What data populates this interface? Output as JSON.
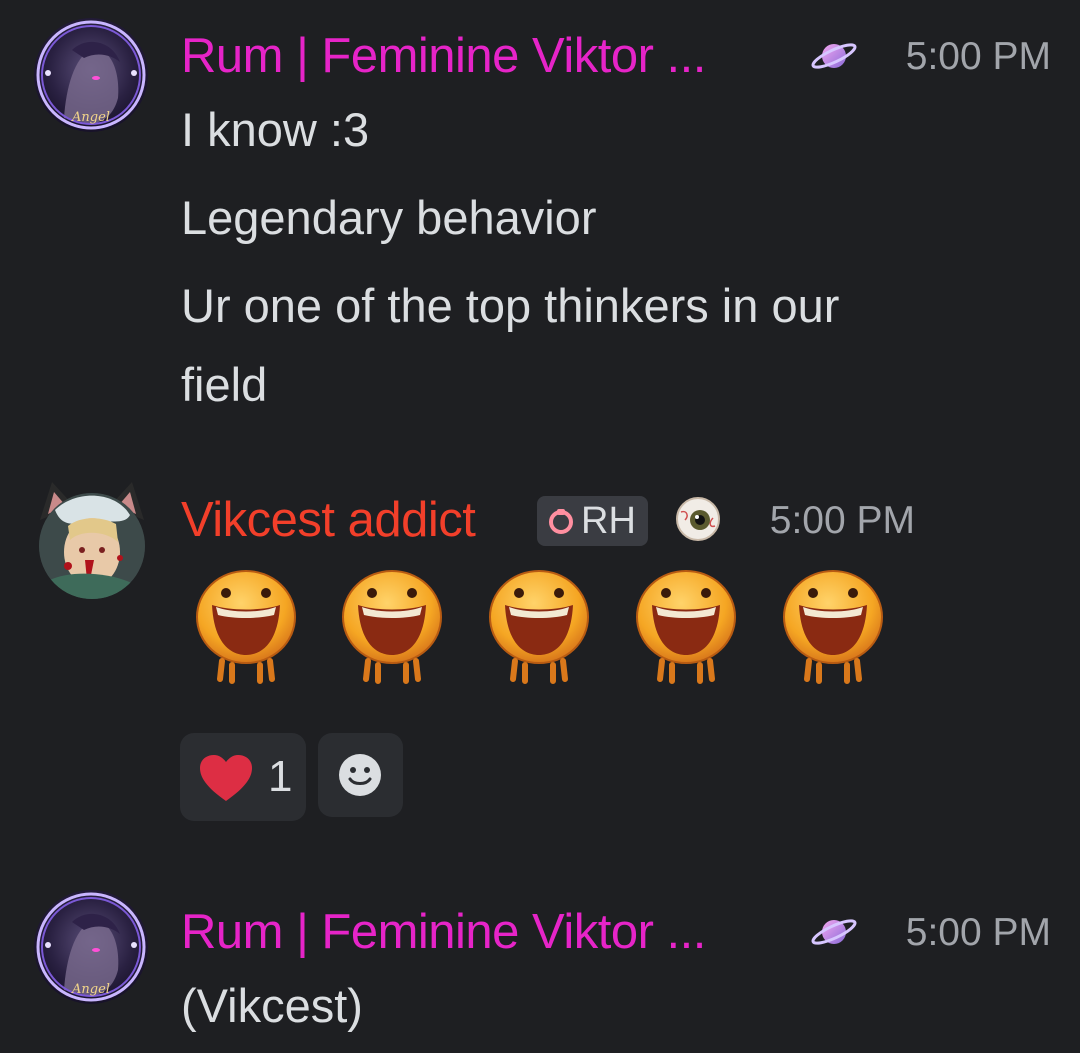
{
  "messages": [
    {
      "author": "Rum | Feminine Viktor ...",
      "author_color": "#e624c8",
      "badge_icon": "ringed-planet-icon",
      "time": "5:00 PM",
      "lines": [
        "I know :3",
        "Legendary behavior",
        "Ur one of the top thinkers in our",
        "field"
      ],
      "avatar_frame_text": "Angel"
    },
    {
      "author": "Vikcest addict",
      "author_color": "#f23f2a",
      "role_tag": {
        "text": "RH",
        "icon": "role-ring-icon"
      },
      "badge_icon": "eyeball-icon",
      "time": "5:00 PM",
      "emotes": [
        "laughing-face-emote",
        "laughing-face-emote",
        "laughing-face-emote",
        "laughing-face-emote",
        "laughing-face-emote"
      ],
      "reactions": [
        {
          "icon": "heart-icon",
          "count": "1"
        },
        {
          "icon": "add-reaction-smiley-icon"
        }
      ]
    },
    {
      "author": "Rum | Feminine Viktor ...",
      "author_color": "#e624c8",
      "badge_icon": "ringed-planet-icon",
      "time": "5:00 PM",
      "lines": [
        "(Vikcest)"
      ],
      "avatar_frame_text": "Angel"
    }
  ],
  "colors": {
    "background": "#1e1f22",
    "text": "#dbdee1",
    "timestamp": "#a2a5ab",
    "reaction_bg": "#2b2d31"
  }
}
